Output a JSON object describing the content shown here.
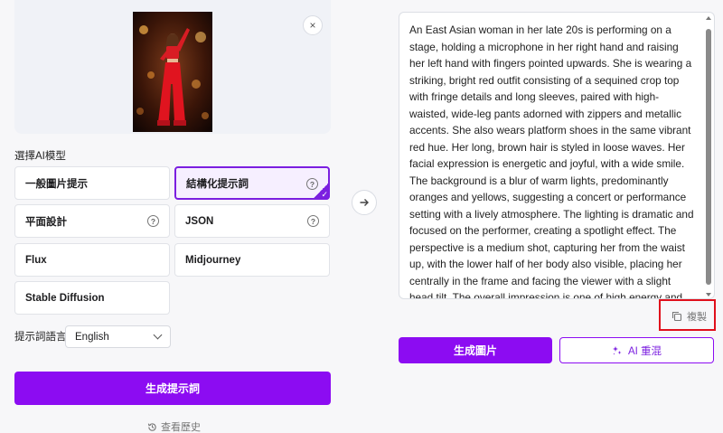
{
  "preview": {
    "close_label": "×"
  },
  "model_section": {
    "label": "選擇AI模型",
    "options": [
      {
        "label": "一般圖片提示",
        "help": false,
        "selected": false
      },
      {
        "label": "結構化提示詞",
        "help": true,
        "selected": true
      },
      {
        "label": "平面設計",
        "help": true,
        "selected": false
      },
      {
        "label": "JSON",
        "help": true,
        "selected": false
      },
      {
        "label": "Flux",
        "help": false,
        "selected": false
      },
      {
        "label": "Midjourney",
        "help": false,
        "selected": false
      },
      {
        "label": "Stable Diffusion",
        "help": false,
        "selected": false
      }
    ],
    "help_glyph": "?"
  },
  "language": {
    "label": "提示詞語言",
    "selected": "English"
  },
  "generate_prompt_button": "生成提示詞",
  "history_link": "查看歷史",
  "output": {
    "text": "An East Asian woman in her late 20s is performing on a stage, holding a microphone in her right hand and raising her left hand with fingers pointed upwards. She is wearing a striking, bright red outfit consisting of a sequined crop top with fringe details and long sleeves, paired with high-waisted, wide-leg pants adorned with zippers and metallic accents. She also wears platform shoes in the same vibrant red hue. Her long, brown hair is styled in loose waves. Her facial expression is energetic and joyful, with a wide smile. The background is a blur of warm lights, predominantly oranges and yellows, suggesting a concert or performance setting with a lively atmosphere. The lighting is dramatic and focused on the performer, creating a spotlight effect. The perspective is a medium shot, capturing her from the waist up, with the lower half of her body also visible, placing her centrally in the frame and facing the viewer with a slight head tilt. The overall impression is one of high energy and showmanship."
  },
  "copy_button": "複製",
  "generate_image_button": "生成圖片",
  "ai_remix_button": "AI 重混",
  "colors": {
    "accent": "#8c0cf2",
    "highlight": "#e0101c"
  }
}
